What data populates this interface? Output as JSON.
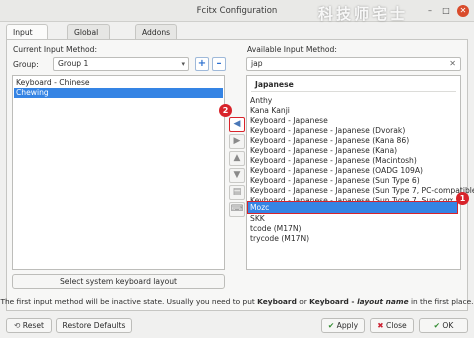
{
  "window": {
    "title": "Fcitx Configuration",
    "watermark": "科技师宅士",
    "minimize_glyph": "–",
    "maximize_glyph": "□",
    "close_glyph": "✕"
  },
  "tabs": [
    "Input Method",
    "Global Options",
    "Addons"
  ],
  "left": {
    "heading": "Current Input Method:",
    "group_label": "Group:",
    "group_value": "Group 1",
    "add_glyph": "+",
    "remove_glyph": "–",
    "items": [
      "Keyboard - Chinese",
      "Chewing"
    ],
    "selected_index": 1,
    "keyboard_layout_button": "Select system keyboard layout"
  },
  "right": {
    "heading": "Available Input Method:",
    "search_value": "jap",
    "category": "Japanese",
    "items": [
      "Anthy",
      "Kana Kanji",
      "Keyboard - Japanese",
      "Keyboard - Japanese - Japanese (Dvorak)",
      "Keyboard - Japanese - Japanese (Kana 86)",
      "Keyboard - Japanese - Japanese (Kana)",
      "Keyboard - Japanese - Japanese (Macintosh)",
      "Keyboard - Japanese - Japanese (OADG 109A)",
      "Keyboard - Japanese - Japanese (Sun Type 6)",
      "Keyboard - Japanese - Japanese (Sun Type 7, PC-compatible)",
      "Keyboard - Japanese - Japanese (Sun Type 7, Sun-compati",
      "Mozc",
      "SKK",
      "tcode (M17N)",
      "trycode (M17N)"
    ],
    "selected_index": 11
  },
  "annotations": {
    "badge_1": "1",
    "badge_2": "2"
  },
  "footer": {
    "note_prefix": "The first input method will be inactive state. Usually you need to put ",
    "note_keyboard": "Keyboard",
    "note_or": " or ",
    "note_keyboard_layout": "Keyboard - ",
    "note_layout_name": "layout name",
    "note_suffix": " in the first place.",
    "reset": "Reset",
    "restore_defaults": "Restore Defaults",
    "apply": "Apply",
    "close": "Close",
    "ok": "OK"
  }
}
